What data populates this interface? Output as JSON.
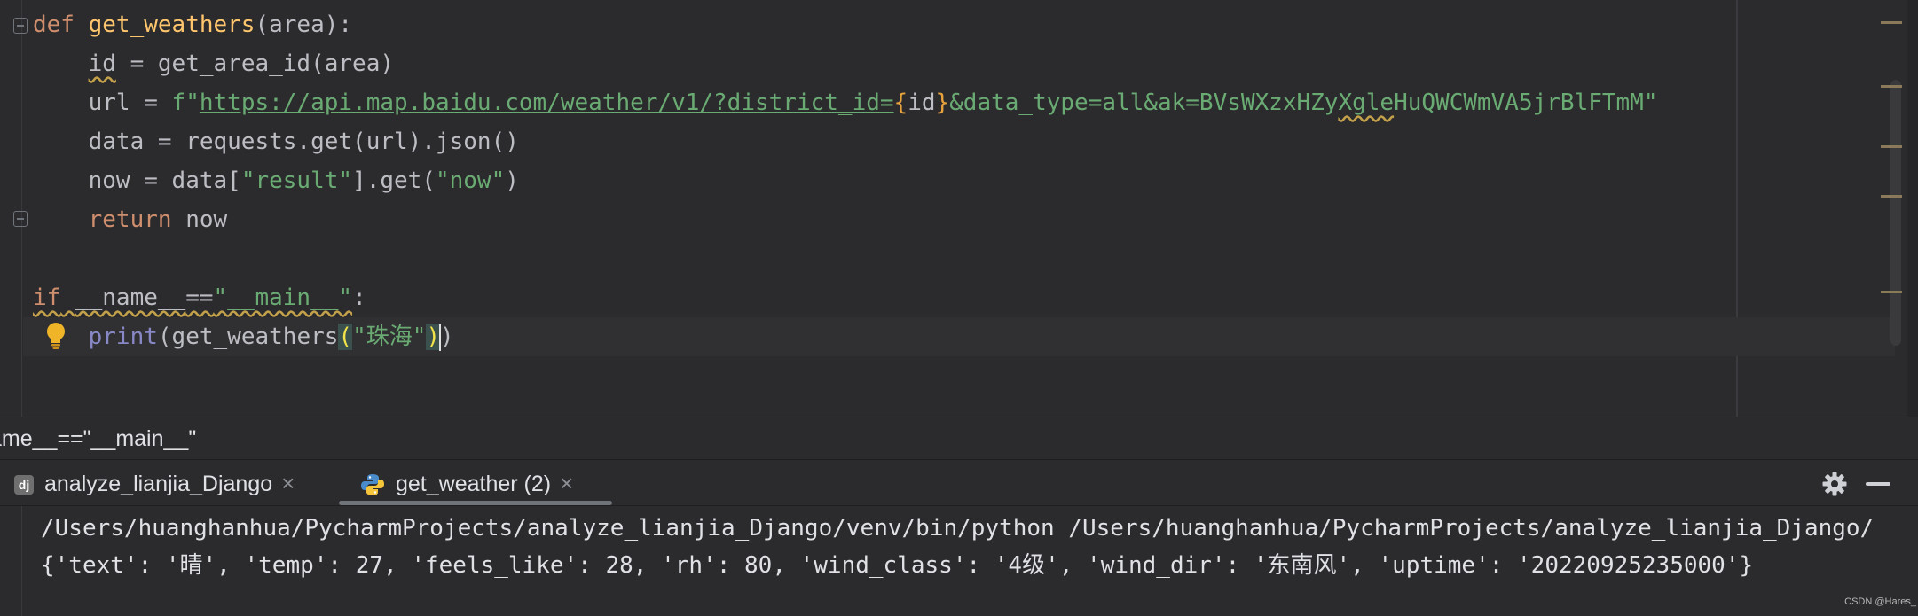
{
  "editor": {
    "line1": {
      "kw": "def",
      "fn": "get_weathers",
      "rest": "(area):"
    },
    "line2": {
      "var": "id",
      "rest": " = get_area_id(area)"
    },
    "line3": {
      "lhs": "url = ",
      "prefix": "f\"",
      "url_part": "https://api.map.baidu.com/weather/v1/?district_id=",
      "brace_open": "{",
      "interp": "id",
      "brace_close": "}",
      "tail_a": "&data_type=all&ak=BVsWXzxHZy",
      "tail_sq": "Xgle",
      "tail_b": "HuQWCWmVA5jrBlFTmM\""
    },
    "line4": "data = requests.get(url).json()",
    "line5": {
      "pre": "now = data[",
      "s1": "\"result\"",
      "mid": "].get(",
      "s2": "\"now\"",
      "post": ")"
    },
    "line6": {
      "kw": "return",
      "rest": " now"
    },
    "line8": {
      "kw": "if",
      "sp": " ",
      "name": "__name__",
      "eq": "==",
      "s": "\"__main__\"",
      "colon": ":"
    },
    "line9": {
      "builtin": "print",
      "p1": "(get_weathers",
      "po": "(",
      "s": "\"珠海\"",
      "pc": ")",
      "end": ")"
    }
  },
  "breadcrumb": {
    "text": "ame__==\"__main__\""
  },
  "run_tabs": [
    {
      "label": "analyze_lianjia_Django",
      "icon": "django-icon",
      "close": "×"
    },
    {
      "label": "get_weather (2)",
      "icon": "python-icon",
      "close": "×"
    }
  ],
  "console": {
    "line1": "/Users/huanghanhua/PycharmProjects/analyze_lianjia_Django/venv/bin/python /Users/huanghanhua/PycharmProjects/analyze_lianjia_Django/",
    "line2": "{'text': '晴', 'temp': 27, 'feels_like': 28, 'rh': 80, 'wind_class': '4级', 'wind_dir': '东南风', 'uptime': '20220925235000'}"
  },
  "watermark": "CSDN @Hares_",
  "icons": {
    "dj_badge": "dj"
  },
  "colors": {
    "keyword": "#cf8e6d",
    "function": "#ffc66d",
    "string": "#6aab73",
    "builtin": "#8888c6",
    "background": "#2b2b2d"
  }
}
